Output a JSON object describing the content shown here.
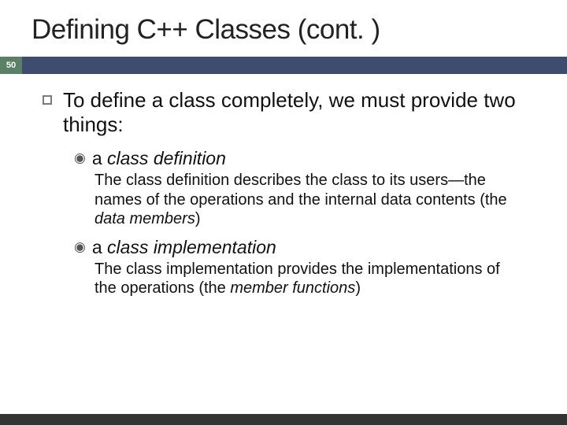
{
  "title": "Defining C++ Classes (cont. )",
  "slide_number": "50",
  "main_bullet": "To define a class completely, we must provide two things:",
  "subs": [
    {
      "label_prefix": "a ",
      "label_italic": "class definition",
      "desc_before": "The class definition describes the class to its users—the names of the operations and the internal data contents (the ",
      "desc_italic": "data members",
      "desc_after": ")"
    },
    {
      "label_prefix": "a ",
      "label_italic": "class implementation",
      "desc_before": "The class implementation provides the implementations of the operations (the ",
      "desc_italic": "member functions",
      "desc_after": ")"
    }
  ]
}
